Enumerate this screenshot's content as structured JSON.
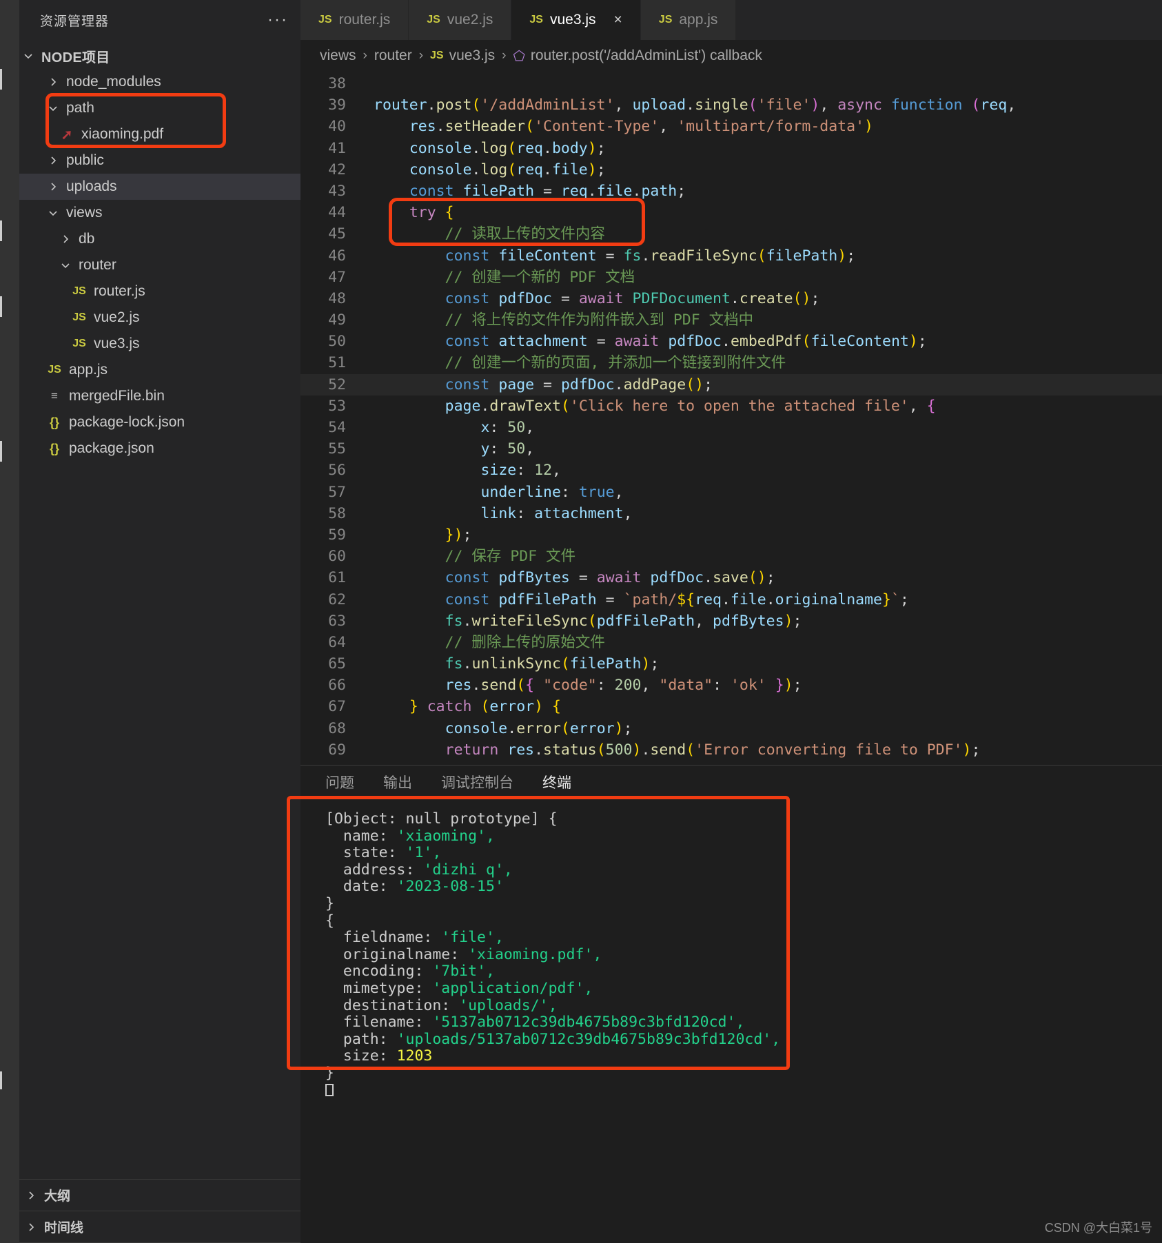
{
  "explorer": {
    "title": "资源管理器",
    "more_icon": "ellipsis-icon",
    "root": "NODE项目",
    "items": [
      {
        "label": "node_modules",
        "type": "folder",
        "state": "collapsed",
        "indent": 1
      },
      {
        "label": "path",
        "type": "folder",
        "state": "expanded",
        "indent": 1
      },
      {
        "label": "xiaoming.pdf",
        "type": "pdf",
        "indent": 2
      },
      {
        "label": "public",
        "type": "folder",
        "state": "collapsed",
        "indent": 1
      },
      {
        "label": "uploads",
        "type": "folder",
        "state": "collapsed",
        "indent": 1,
        "selected": true
      },
      {
        "label": "views",
        "type": "folder",
        "state": "expanded",
        "indent": 1
      },
      {
        "label": "db",
        "type": "folder",
        "state": "collapsed",
        "indent": 2
      },
      {
        "label": "router",
        "type": "folder",
        "state": "expanded",
        "indent": 2
      },
      {
        "label": "router.js",
        "type": "js",
        "indent": 3
      },
      {
        "label": "vue2.js",
        "type": "js",
        "indent": 3
      },
      {
        "label": "vue3.js",
        "type": "js",
        "indent": 3
      },
      {
        "label": "app.js",
        "type": "js",
        "indent": 1
      },
      {
        "label": "mergedFile.bin",
        "type": "bin",
        "indent": 1
      },
      {
        "label": "package-lock.json",
        "type": "json",
        "indent": 1
      },
      {
        "label": "package.json",
        "type": "json",
        "indent": 1
      }
    ],
    "sections": [
      {
        "label": "大纲",
        "state": "collapsed"
      },
      {
        "label": "时间线",
        "state": "collapsed"
      }
    ]
  },
  "tabs": [
    {
      "label": "router.js",
      "icon": "js-icon",
      "active": false
    },
    {
      "label": "vue2.js",
      "icon": "js-icon",
      "active": false
    },
    {
      "label": "vue3.js",
      "icon": "js-icon",
      "active": true,
      "close": "×"
    },
    {
      "label": "app.js",
      "icon": "js-icon",
      "active": false
    }
  ],
  "breadcrumb": {
    "items": [
      "views",
      "router",
      "vue3.js",
      "router.post('/addAdminList') callback"
    ],
    "separator": "›",
    "file_icon": "js-icon",
    "symbol_icon": "symbol-method-icon"
  },
  "editor": {
    "first_line": 38,
    "current_line": 52,
    "lines": [
      {
        "n": 38,
        "text": ""
      },
      {
        "n": 39,
        "text": "router.post('/addAdminList', upload.single('file'), async function (req,"
      },
      {
        "n": 40,
        "text": "    res.setHeader('Content-Type', 'multipart/form-data')"
      },
      {
        "n": 41,
        "text": "    console.log(req.body);"
      },
      {
        "n": 42,
        "text": "    console.log(req.file);"
      },
      {
        "n": 43,
        "text": "    const filePath = req.file.path;"
      },
      {
        "n": 44,
        "text": "    try {"
      },
      {
        "n": 45,
        "text": "        // 读取上传的文件内容"
      },
      {
        "n": 46,
        "text": "        const fileContent = fs.readFileSync(filePath);"
      },
      {
        "n": 47,
        "text": "        // 创建一个新的 PDF 文档"
      },
      {
        "n": 48,
        "text": "        const pdfDoc = await PDFDocument.create();"
      },
      {
        "n": 49,
        "text": "        // 将上传的文件作为附件嵌入到 PDF 文档中"
      },
      {
        "n": 50,
        "text": "        const attachment = await pdfDoc.embedPdf(fileContent);"
      },
      {
        "n": 51,
        "text": "        // 创建一个新的页面, 并添加一个链接到附件文件"
      },
      {
        "n": 52,
        "text": "        const page = pdfDoc.addPage();"
      },
      {
        "n": 53,
        "text": "        page.drawText('Click here to open the attached file', {"
      },
      {
        "n": 54,
        "text": "            x: 50,"
      },
      {
        "n": 55,
        "text": "            y: 50,"
      },
      {
        "n": 56,
        "text": "            size: 12,"
      },
      {
        "n": 57,
        "text": "            underline: true,"
      },
      {
        "n": 58,
        "text": "            link: attachment,"
      },
      {
        "n": 59,
        "text": "        });"
      },
      {
        "n": 60,
        "text": "        // 保存 PDF 文件"
      },
      {
        "n": 61,
        "text": "        const pdfBytes = await pdfDoc.save();"
      },
      {
        "n": 62,
        "text": "        const pdfFilePath = `path/${req.file.originalname}`;"
      },
      {
        "n": 63,
        "text": "        fs.writeFileSync(pdfFilePath, pdfBytes);"
      },
      {
        "n": 64,
        "text": "        // 删除上传的原始文件"
      },
      {
        "n": 65,
        "text": "        fs.unlinkSync(filePath);"
      },
      {
        "n": 66,
        "text": "        res.send({ \"code\": 200, \"data\": 'ok' });"
      },
      {
        "n": 67,
        "text": "    } catch (error) {"
      },
      {
        "n": 68,
        "text": "        console.error(error);"
      },
      {
        "n": 69,
        "text": "        return res.status(500).send('Error converting file to PDF');"
      }
    ]
  },
  "panel": {
    "tabs": [
      {
        "label": "问题",
        "active": false
      },
      {
        "label": "输出",
        "active": false
      },
      {
        "label": "调试控制台",
        "active": false
      },
      {
        "label": "终端",
        "active": true
      }
    ],
    "terminal_lines": [
      "[Object: null prototype] {",
      "  name: 'xiaoming',",
      "  state: '1',",
      "  address: 'dizhi q',",
      "  date: '2023-08-15'",
      "}",
      "{",
      "  fieldname: 'file',",
      "  originalname: 'xiaoming.pdf',",
      "  encoding: '7bit',",
      "  mimetype: 'application/pdf',",
      "  destination: 'uploads/',",
      "  filename: '5137ab0712c39db4675b89c3bfd120cd',",
      "  path: 'uploads/5137ab0712c39db4675b89c3bfd120cd',",
      "  size: 1203",
      "}"
    ]
  },
  "annotations": {
    "color": "#f23c12",
    "boxes": [
      "explorer-path-folder",
      "console-log-lines",
      "terminal-output"
    ]
  },
  "watermark": "CSDN @大白菜1号",
  "colors": {
    "accent_red": "#f23c12",
    "editor_bg": "#1e1e1e",
    "sidebar_bg": "#252526",
    "activitybar_bg": "#333333",
    "string_green": "#23d18b",
    "number_yellow": "#f5f543"
  }
}
